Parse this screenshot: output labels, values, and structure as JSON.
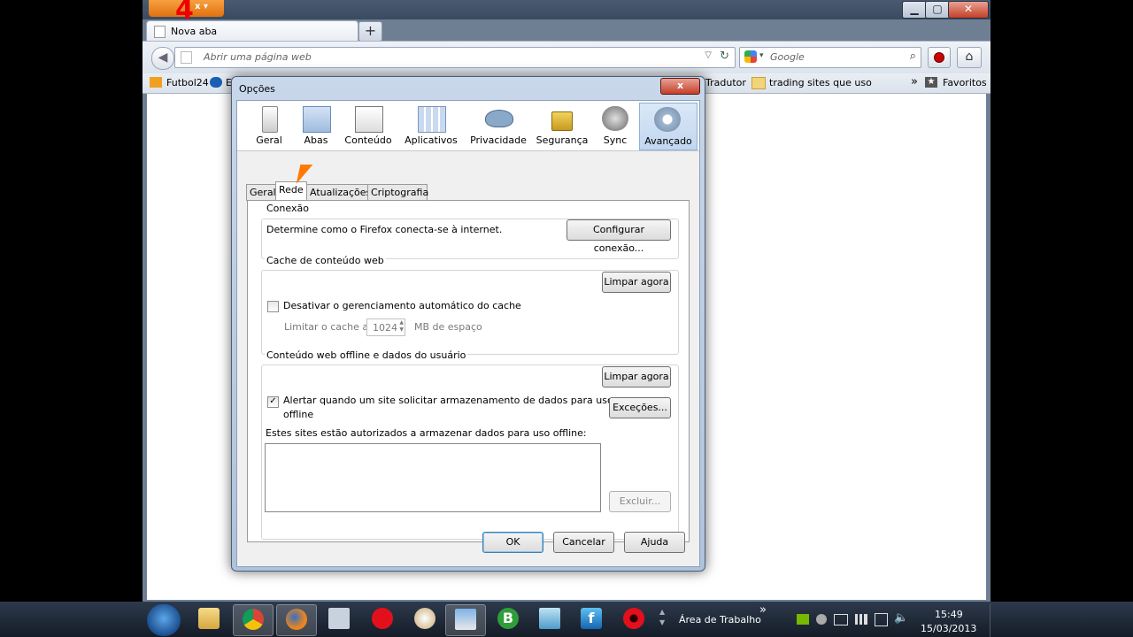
{
  "browser": {
    "tab_title": "Nova aba",
    "new_tab": "+",
    "url_placeholder": "Abrir uma página web",
    "search_placeholder": "Google",
    "menu_glyph": "x ▾",
    "window_controls": [
      "▁",
      "▢",
      "✕"
    ]
  },
  "bookmarks": {
    "items": [
      "Futbol24",
      "E",
      "Tradutor",
      "trading sites que uso"
    ],
    "overflow": "»",
    "favorites": "Favoritos"
  },
  "dialog": {
    "title": "Opções",
    "close": "x",
    "toolbar": [
      "Geral",
      "Abas",
      "Conteúdo",
      "Aplicativos",
      "Privacidade",
      "Segurança",
      "Sync",
      "Avançado"
    ],
    "selected_pane": "Avançado",
    "subtabs": [
      "Geral",
      "Rede",
      "Atualizações",
      "Criptografia"
    ],
    "selected_subtab": "Rede",
    "connection": {
      "title": "Conexão",
      "description": "Determine como o Firefox conecta-se à internet.",
      "button": "Configurar conexão..."
    },
    "cache": {
      "title": "Cache de conteúdo web",
      "clear_button": "Limpar agora",
      "override_label": "Desativar o gerenciamento automático do cache",
      "override_checked": false,
      "limit_label": "Limitar o cache a",
      "limit_value": "1024",
      "limit_unit": "MB de espaço"
    },
    "offline": {
      "title": "Conteúdo web offline e dados do usuário",
      "clear_button": "Limpar agora",
      "alert_label_line1": "Alertar quando um site solicitar armazenamento de dados para uso",
      "alert_label_line2": "offline",
      "alert_checked": true,
      "exceptions_button": "Exceções...",
      "sites_label": "Estes sites estão autorizados a armazenar dados para uso offline:",
      "remove_button": "Excluir..."
    },
    "footer": {
      "ok": "OK",
      "cancel": "Cancelar",
      "help": "Ajuda"
    }
  },
  "taskbar": {
    "desktop_label": "Área de Trabalho",
    "overflow": "»",
    "time": "15:49",
    "date": "15/03/2013"
  },
  "overlay": {
    "mark": "4"
  },
  "colors": {
    "firefox_orange": "#e9851f",
    "selection_blue": "#c1d6ef",
    "cursor": "#ff7a00"
  }
}
